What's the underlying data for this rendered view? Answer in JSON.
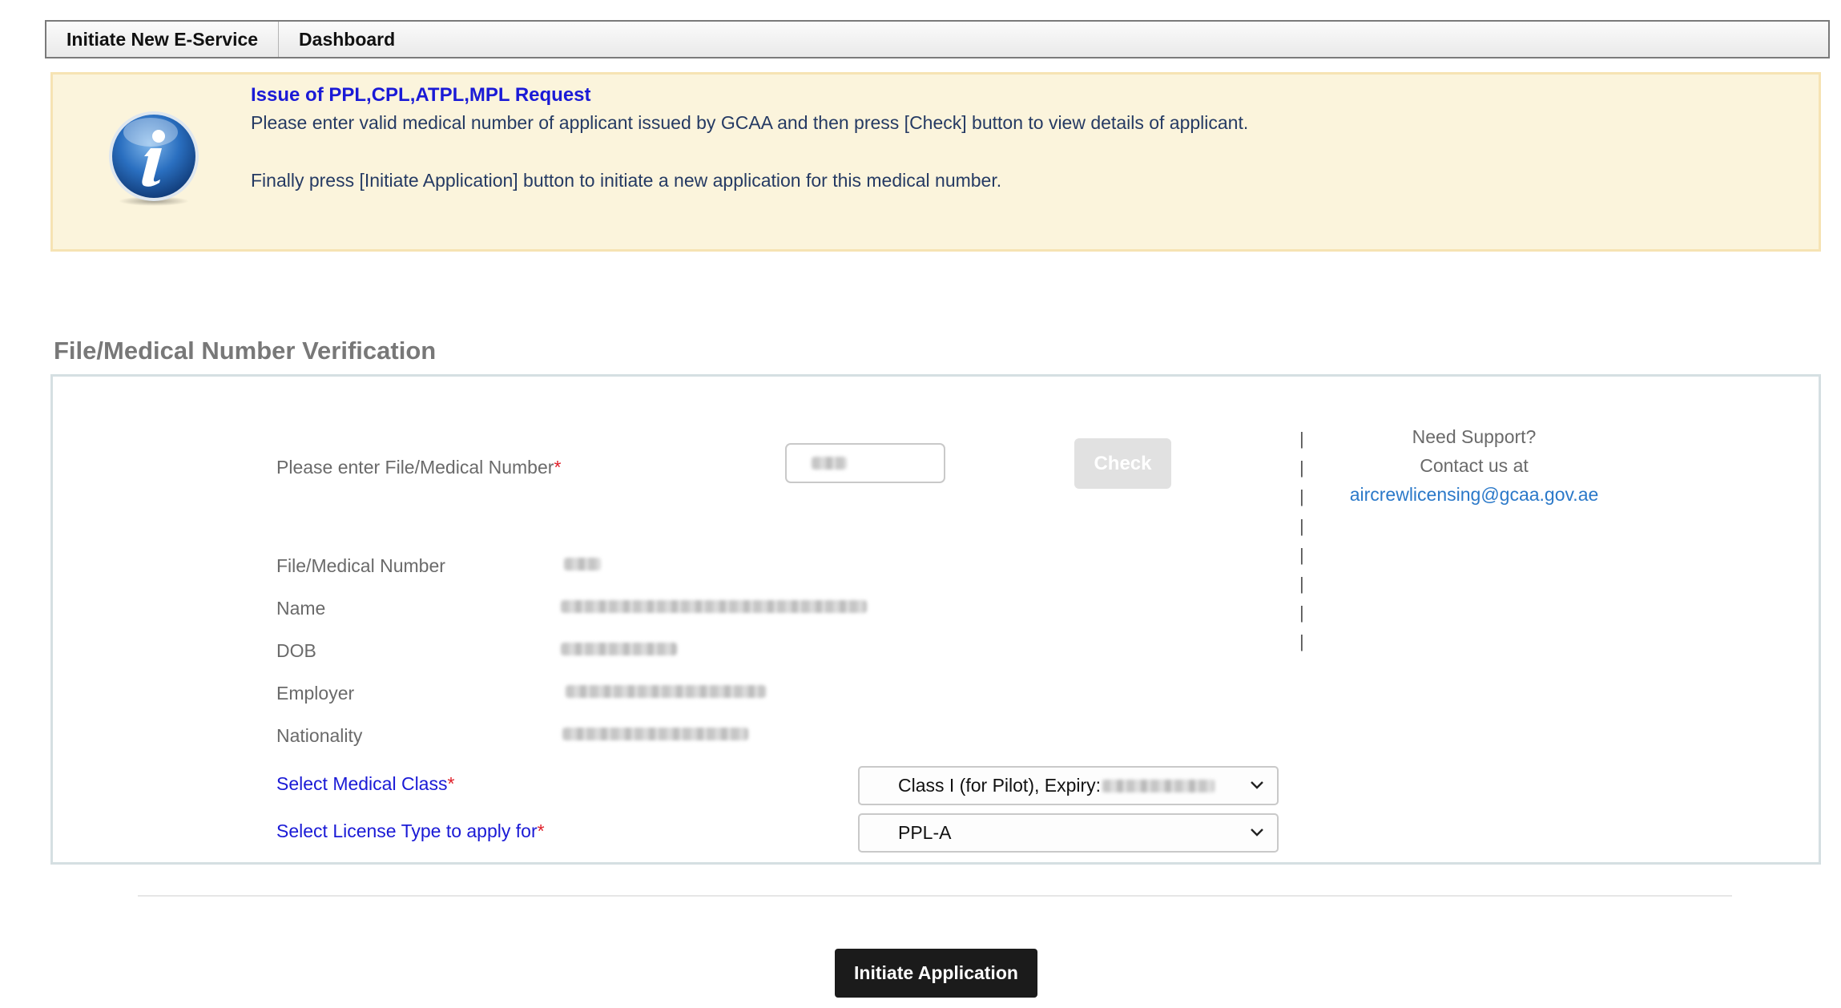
{
  "nav": {
    "tabs": [
      {
        "label": "Initiate New E-Service"
      },
      {
        "label": "Dashboard"
      }
    ]
  },
  "info": {
    "icon": "info-icon",
    "title": "Issue of PPL,CPL,ATPL,MPL Request",
    "line1": "Please enter valid medical number of applicant issued by GCAA and then press [Check] button to view details of applicant.",
    "line2": "Finally press [Initiate Application] button to initiate a new application for this medical number."
  },
  "section": {
    "title": "File/Medical Number Verification"
  },
  "form": {
    "medical_label": "Please enter File/Medical Number",
    "required_mark": "*",
    "medical_value": "",
    "check_label": "Check",
    "details": {
      "file_label": "File/Medical Number",
      "name_label": "Name",
      "dob_label": "DOB",
      "employer_label": "Employer",
      "nationality_label": "Nationality"
    },
    "medical_class_label": "Select Medical Class",
    "medical_class_value": "Class I (for Pilot), Expiry:",
    "license_type_label": "Select License Type to apply for",
    "license_type_value": "PPL-A"
  },
  "support": {
    "line1": "Need Support?",
    "line2": "Contact us at",
    "email": "aircrewlicensing@gcaa.gov.ae"
  },
  "actions": {
    "initiate_label": "Initiate Application"
  },
  "colors": {
    "link_blue": "#1a1ad6",
    "required_red": "#e0202a",
    "banner_bg": "#fbf4dc",
    "button_dark": "#1b1b1b",
    "email_blue": "#2b79c9"
  }
}
